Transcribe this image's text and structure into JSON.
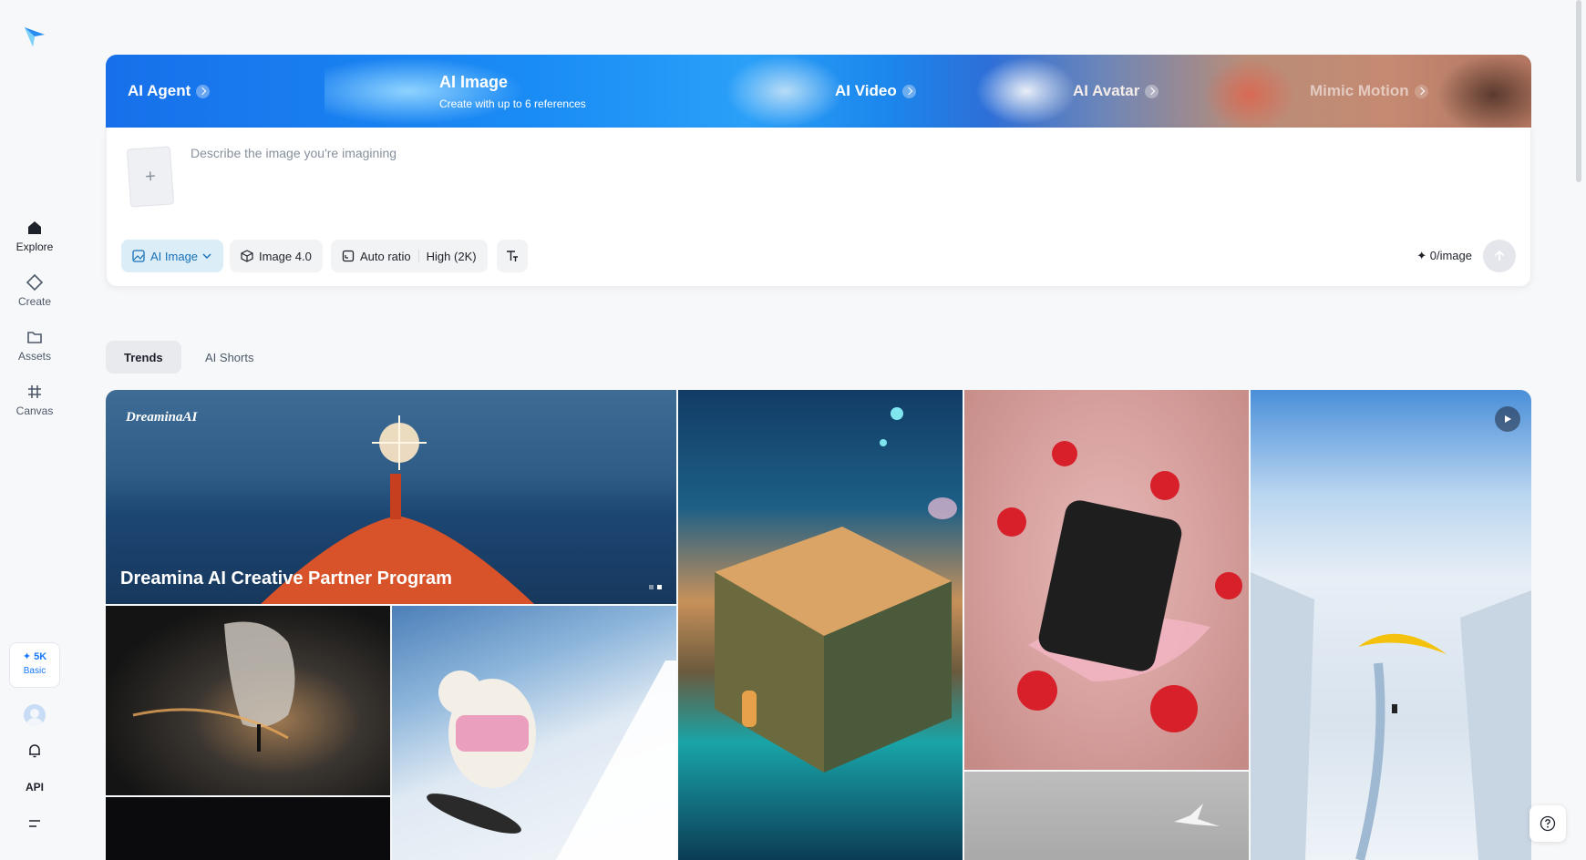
{
  "nav": {
    "items": [
      {
        "label": "Explore",
        "icon": "home-icon"
      },
      {
        "label": "Create",
        "icon": "diamond-icon"
      },
      {
        "label": "Assets",
        "icon": "folder-icon"
      },
      {
        "label": "Canvas",
        "icon": "hash-frame-icon"
      }
    ]
  },
  "credits": {
    "value": "✦ 5K",
    "plan": "Basic"
  },
  "api_label": "API",
  "banner": {
    "agent": "AI Agent",
    "image_title": "AI Image",
    "image_sub": "Create with up to 6 references",
    "video": "AI Video",
    "avatar": "AI Avatar",
    "mimic": "Mimic Motion"
  },
  "prompt": {
    "placeholder": "Describe the image you're imagining",
    "add_symbol": "+",
    "mode": "AI Image",
    "model": "Image 4.0",
    "ratio": "Auto ratio",
    "quality": "High (2K)",
    "cost": "✦ 0/image"
  },
  "tabs": [
    {
      "label": "Trends",
      "active": true
    },
    {
      "label": "AI Shorts",
      "active": false
    }
  ],
  "gallery": {
    "hero_watermark": "DreaminaAI",
    "hero_title": "Dreamina AI Creative Partner Program",
    "hero_slides": 2,
    "hero_active_slide": 2
  },
  "colors": {
    "accent": "#1677ff",
    "mode_chip_bg": "#dbeef7",
    "mode_chip_text": "#1670b8"
  }
}
